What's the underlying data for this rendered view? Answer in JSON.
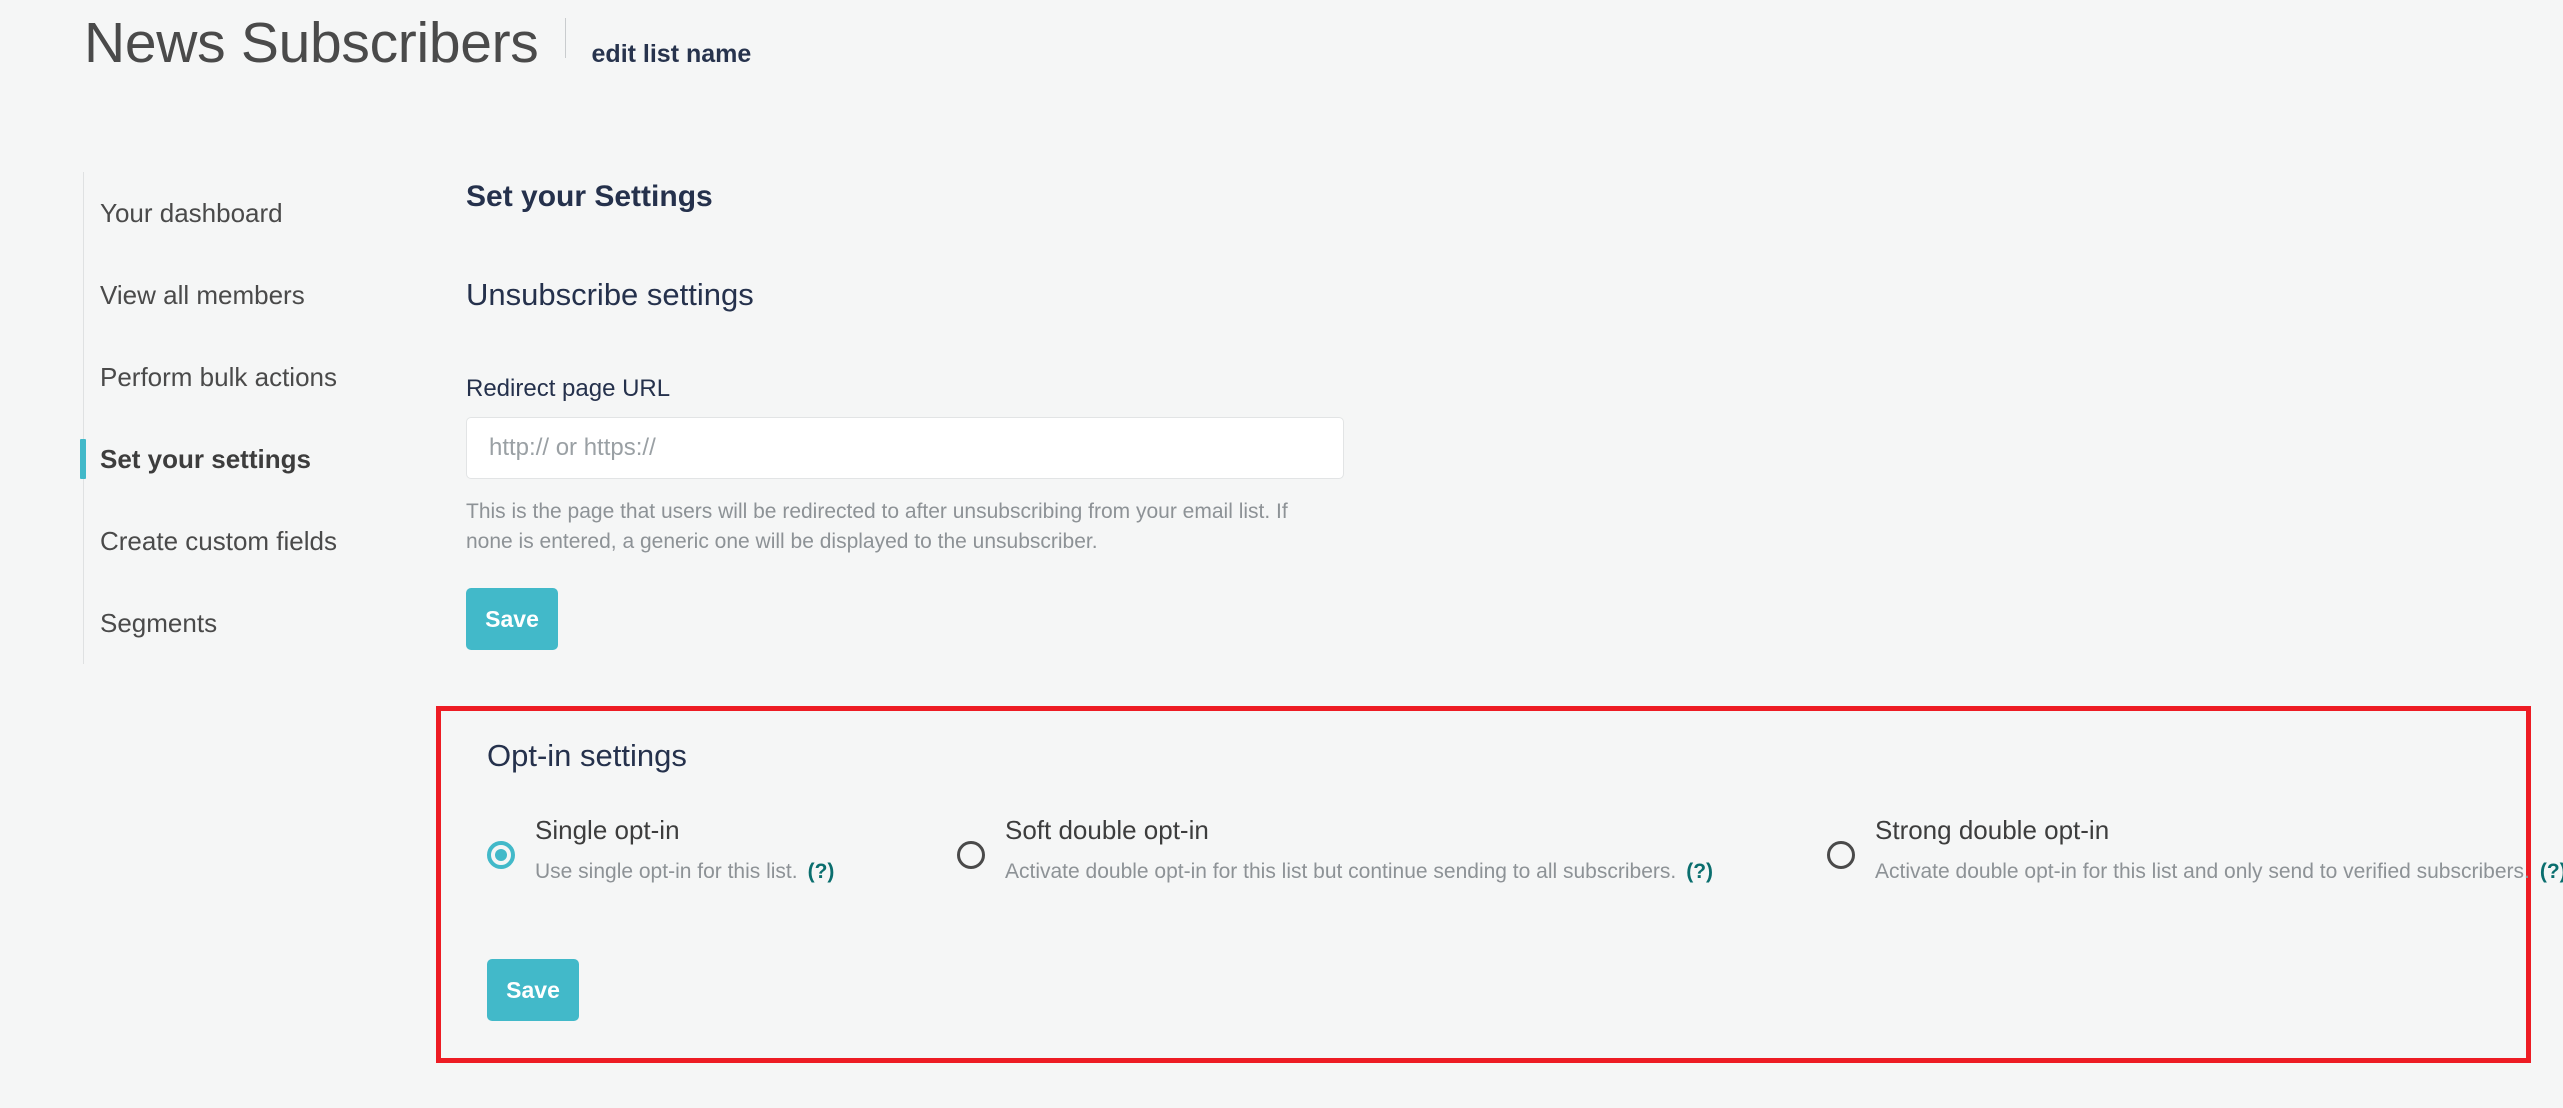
{
  "header": {
    "title": "News Subscribers",
    "edit_link": "edit list name"
  },
  "sidebar": {
    "items": [
      {
        "label": "Your dashboard",
        "active": false
      },
      {
        "label": "View all members",
        "active": false
      },
      {
        "label": "Perform bulk actions",
        "active": false
      },
      {
        "label": "Set your settings",
        "active": true
      },
      {
        "label": "Create custom fields",
        "active": false
      },
      {
        "label": "Segments",
        "active": false
      }
    ]
  },
  "main": {
    "page_heading": "Set your Settings",
    "unsubscribe": {
      "heading": "Unsubscribe settings",
      "field_label": "Redirect page URL",
      "input_value": "",
      "input_placeholder": "http:// or https://",
      "help_text": "This is the page that users will be redirected to after unsubscribing from your email list. If none is entered, a generic one will be displayed to the unsubscriber.",
      "save_label": "Save"
    },
    "optin": {
      "heading": "Opt-in settings",
      "options": [
        {
          "title": "Single opt-in",
          "description": "Use single opt-in for this list.",
          "help": "(?)",
          "selected": true
        },
        {
          "title": "Soft double opt-in",
          "description": "Activate double opt-in for this list but continue sending to all subscribers.",
          "help": "(?)",
          "selected": false
        },
        {
          "title": "Strong double opt-in",
          "description": "Activate double opt-in for this list and only send to verified subscribers.",
          "help": "(?)",
          "selected": false
        }
      ],
      "save_label": "Save"
    }
  },
  "colors": {
    "accent_teal": "#42b9c9",
    "heading_navy": "#25314c",
    "highlight_red": "#ed1c24",
    "help_link": "#0a6e6e",
    "background": "#f5f6f6"
  }
}
